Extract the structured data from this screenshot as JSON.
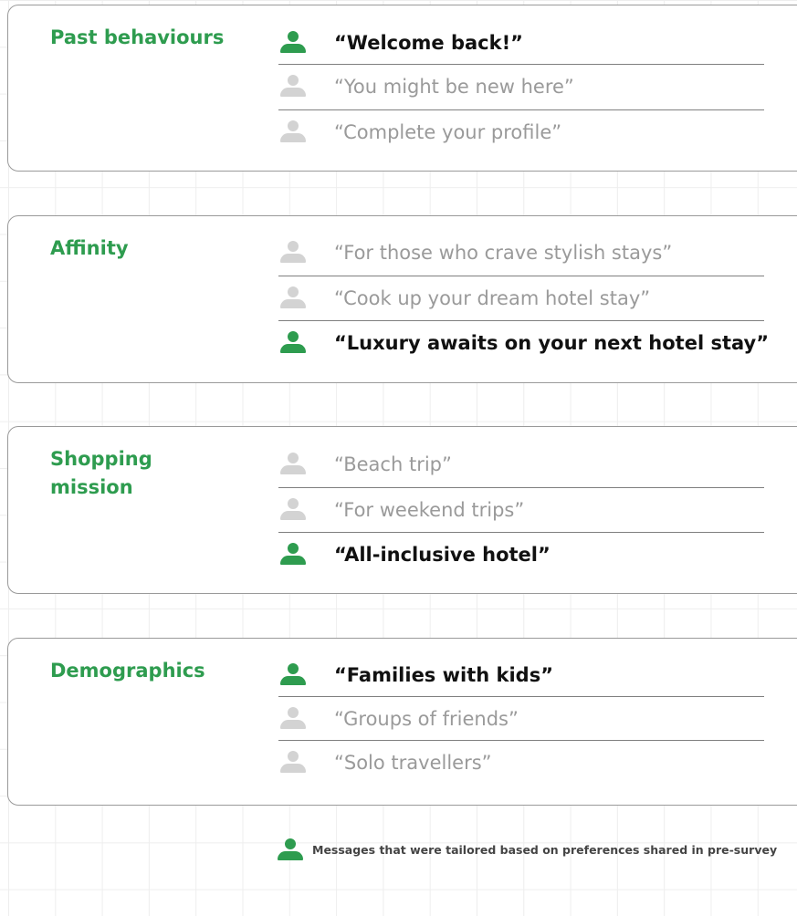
{
  "categories": [
    {
      "title": "Past behaviours",
      "options": [
        {
          "text": "“Welcome back!”",
          "tailored": true
        },
        {
          "text": "“You might be new here”",
          "tailored": false
        },
        {
          "text": "“Complete your profile”",
          "tailored": false
        }
      ]
    },
    {
      "title": "Affinity",
      "options": [
        {
          "text": "“For those who crave stylish stays”",
          "tailored": false
        },
        {
          "text": "“Cook up your dream hotel stay”",
          "tailored": false
        },
        {
          "text": "“Luxury awaits on your next hotel stay”",
          "tailored": true
        }
      ]
    },
    {
      "title": "Shopping mission",
      "options": [
        {
          "text": "“Beach trip”",
          "tailored": false
        },
        {
          "text": "“For weekend trips”",
          "tailored": false
        },
        {
          "text": "“All-inclusive hotel”",
          "tailored": true
        }
      ]
    },
    {
      "title": "Demographics",
      "options": [
        {
          "text": "“Families with kids”",
          "tailored": true
        },
        {
          "text": "“Groups of friends”",
          "tailored": false
        },
        {
          "text": "“Solo travellers”",
          "tailored": false
        }
      ]
    }
  ],
  "legend": {
    "icon": "person-icon",
    "text": "Messages that were tailored based on preferences shared in pre-survey"
  },
  "colors": {
    "accent_green": "#2e9c4f",
    "inactive_icon": "#d3d3d3",
    "inactive_text": "#9a9a9a",
    "active_text": "#111111"
  }
}
